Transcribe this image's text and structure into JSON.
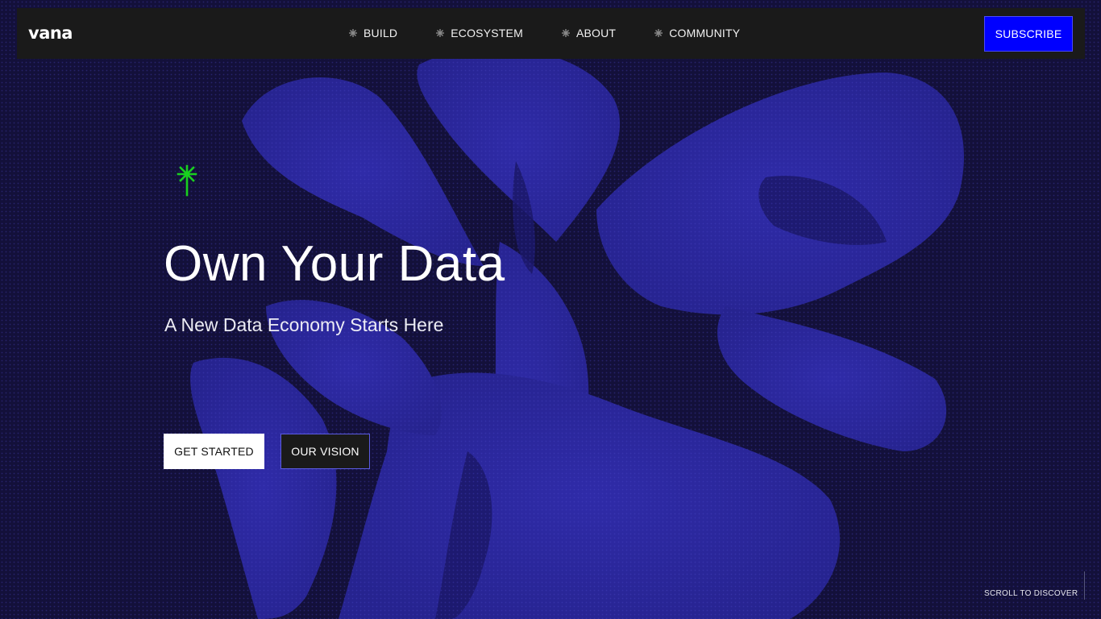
{
  "header": {
    "logo_text": "vana",
    "nav": [
      {
        "label": "BUILD"
      },
      {
        "label": "ECOSYSTEM"
      },
      {
        "label": "ABOUT"
      },
      {
        "label": "COMMUNITY"
      }
    ],
    "subscribe_label": "SUBSCRIBE"
  },
  "hero": {
    "icon": "asterisk-sprout-icon",
    "title": "Own Your Data",
    "subtitle": "A New Data Economy Starts Here",
    "primary_button": "GET STARTED",
    "secondary_button": "OUR VISION"
  },
  "footer_hint": {
    "scroll_label": "SCROLL TO DISCOVER"
  },
  "colors": {
    "background": "#13103a",
    "flower": "#2a269a",
    "navbar": "#1a1a1a",
    "subscribe": "#0000ff",
    "accent_icon": "#19d11f"
  }
}
